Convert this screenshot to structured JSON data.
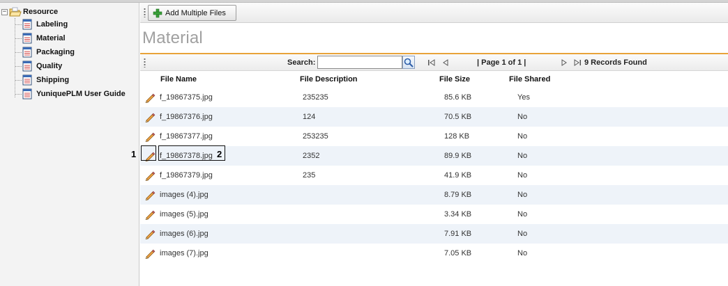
{
  "sidebar": {
    "root_label": "Resource",
    "toggle_symbol": "−",
    "items": [
      {
        "label": "Labeling",
        "icon": "document-icon"
      },
      {
        "label": "Material",
        "icon": "document-icon"
      },
      {
        "label": "Packaging",
        "icon": "document-icon"
      },
      {
        "label": "Quality",
        "icon": "document-icon"
      },
      {
        "label": "Shipping",
        "icon": "document-icon"
      },
      {
        "label": "YuniquePLM User Guide",
        "icon": "document-icon"
      }
    ]
  },
  "toolbar": {
    "add_button_label": "Add Multiple Files",
    "add_icon": "plus-icon"
  },
  "page_title": "Material",
  "grid": {
    "search_label": "Search:",
    "search_value": "",
    "search_icon": "magnifier-icon",
    "page_text": "| Page 1 of 1 |",
    "records_text": "9 Records Found",
    "columns": [
      "File Name",
      "File Description",
      "File Size",
      "File Shared"
    ],
    "rows": [
      {
        "name": "f_19867375.jpg",
        "description": "235235",
        "size": "85.6 KB",
        "shared": "Yes"
      },
      {
        "name": "f_19867376.jpg",
        "description": "124",
        "size": "70.5 KB",
        "shared": "No"
      },
      {
        "name": "f_19867377.jpg",
        "description": "253235",
        "size": "128 KB",
        "shared": "No"
      },
      {
        "name": "f_19867378.jpg",
        "description": "2352",
        "size": "89.9 KB",
        "shared": "No"
      },
      {
        "name": "f_19867379.jpg",
        "description": "235",
        "size": "41.9 KB",
        "shared": "No"
      },
      {
        "name": "images (4).jpg",
        "description": "",
        "size": "8.79 KB",
        "shared": "No"
      },
      {
        "name": "images (5).jpg",
        "description": "",
        "size": "3.34 KB",
        "shared": "No"
      },
      {
        "name": "images (6).jpg",
        "description": "",
        "size": "7.91 KB",
        "shared": "No"
      },
      {
        "name": "images (7).jpg",
        "description": "",
        "size": "7.05 KB",
        "shared": "No"
      }
    ]
  },
  "annotations": {
    "marker_1": "1",
    "marker_2": "2"
  },
  "colors": {
    "accent_orange": "#e8a33a",
    "row_alt": "#eef3f9",
    "title_gray": "#a0a0a0"
  }
}
